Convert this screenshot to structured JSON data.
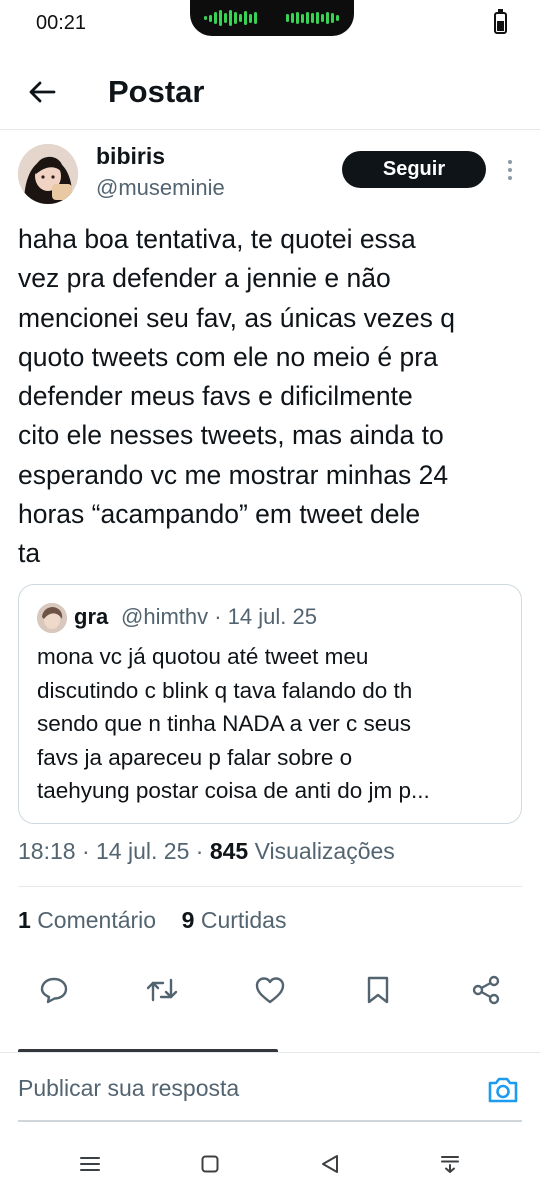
{
  "status": {
    "time": "00:21"
  },
  "header": {
    "title": "Postar"
  },
  "post": {
    "author_name": "bibiris",
    "author_handle": "@museminie",
    "follow_label": "Seguir",
    "text": "haha boa tentativa, te quotei essa\nvez pra defender a jennie e não\nmencionei seu fav, as únicas vezes q\nquoto tweets com ele no meio é pra\ndefender meus favs e dificilmente\ncito ele nesses tweets, mas ainda to\nesperando vc me mostrar minhas 24\nhoras “acampando” em tweet dele\nta",
    "time": "18:18",
    "date": "14 jul. 25",
    "views_count": "845",
    "views_label": "Visualizações",
    "comments_count": "1",
    "comments_label": "Comentário",
    "reposts_count": "9",
    "reposts_label": "Curtidas"
  },
  "quote": {
    "name": "gra",
    "meta": "@himthv · 14 jul. 25",
    "text": "mona vc já quotou até tweet meu\ndiscutindo c blink q tava falando do th\nsendo que n tinha NADA a ver c seus\nfavs ja apareceu p falar sobre o\ntaehyung postar coisa de anti do jm p..."
  },
  "actions": [
    "reply-icon",
    "repost-icon",
    "like-icon",
    "bookmark-icon",
    "share-icon"
  ],
  "reply_bar": {
    "placeholder": "Publicar sua resposta"
  },
  "colors": {
    "text": "#0f1419",
    "muted": "#536471",
    "accent": "#1d9bf0",
    "border": "#cfd9de",
    "wave": "#39d353"
  }
}
